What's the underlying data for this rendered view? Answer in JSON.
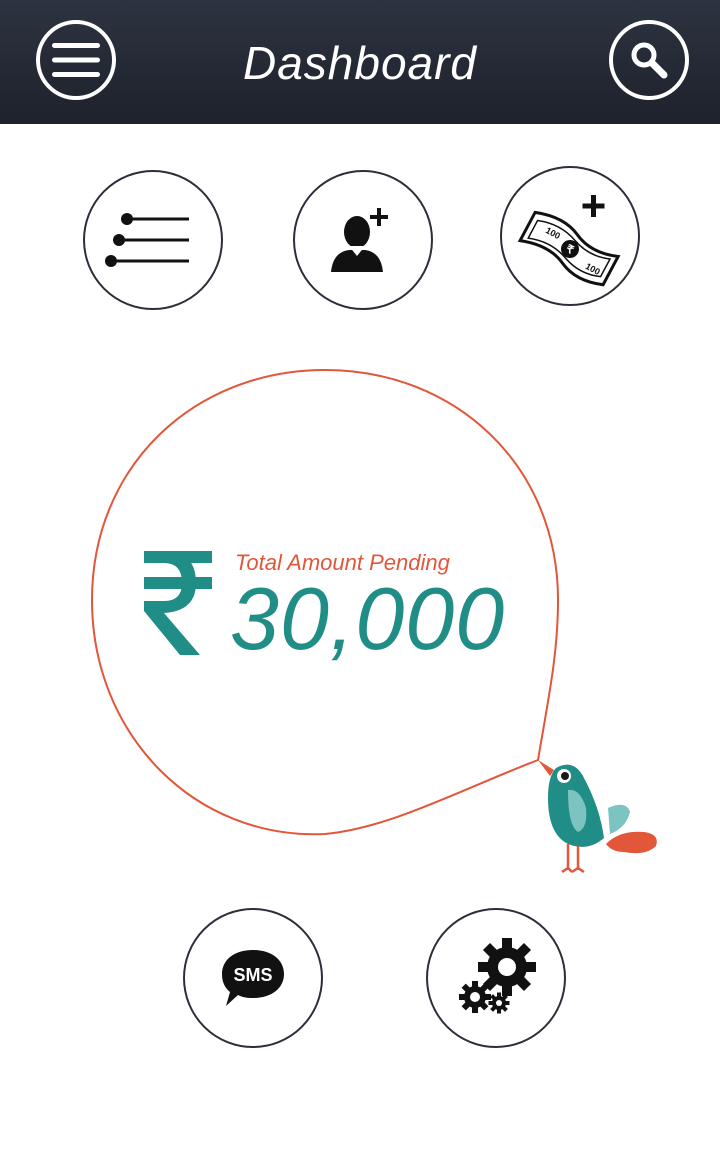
{
  "header": {
    "title": "Dashboard",
    "menu_icon": "hamburger-menu-icon",
    "search_icon": "search-icon"
  },
  "quick_actions": [
    {
      "name": "list-button",
      "icon": "list-icon"
    },
    {
      "name": "add-customer-button",
      "icon": "add-user-icon"
    },
    {
      "name": "add-payment-button",
      "icon": "add-money-icon"
    }
  ],
  "summary": {
    "label": "Total Amount Pending",
    "currency_symbol_icon": "rupee-icon",
    "amount": "30,000"
  },
  "note_text": {
    "currency_note": "100"
  },
  "bottom_actions": [
    {
      "name": "sms-button",
      "icon": "sms-icon",
      "label": "SMS"
    },
    {
      "name": "settings-button",
      "icon": "gears-icon"
    }
  ],
  "colors": {
    "header_bg": "#232833",
    "accent_teal": "#218d87",
    "accent_orange": "#e2563a",
    "circle_border": "#2a2f3a"
  }
}
